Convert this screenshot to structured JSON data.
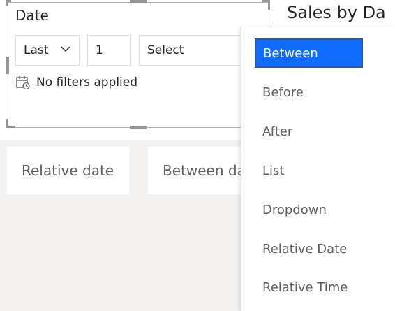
{
  "slicer": {
    "title": "Date",
    "period_mode": "Last",
    "period_count": "1",
    "period_unit_placeholder": "Select",
    "status": "No filters applied"
  },
  "chart": {
    "title": "Sales by Da"
  },
  "cards": [
    {
      "label": "Relative date"
    },
    {
      "label": "Between da"
    }
  ],
  "menu": {
    "selected": "Between",
    "items": [
      {
        "label": "Between"
      },
      {
        "label": "Before"
      },
      {
        "label": "After"
      },
      {
        "label": "List"
      },
      {
        "label": "Dropdown"
      },
      {
        "label": "Relative Date"
      },
      {
        "label": "Relative Time"
      }
    ]
  },
  "icons": {
    "calendar": "calendar-clock-icon",
    "chevron": "chevron-down-icon"
  },
  "colors": {
    "accent": "#0f6cff",
    "text": "#252423",
    "muted": "#605e5c",
    "canvas": "#f3f2f1"
  }
}
